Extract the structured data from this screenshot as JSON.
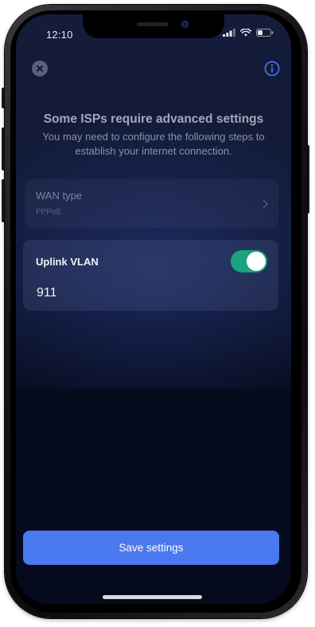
{
  "status_bar": {
    "time": "12:10",
    "signal_icon": "cellular-signal-icon",
    "wifi_icon": "wifi-icon",
    "battery_icon": "battery-icon"
  },
  "header": {
    "close_icon": "close-icon",
    "info_icon": "info-icon"
  },
  "intro": {
    "title": "Some ISPs require advanced settings",
    "description": "You may need to configure the following steps to establish your internet connection."
  },
  "wan_type": {
    "label": "WAN type",
    "value": "PPPoE",
    "chevron_icon": "chevron-right-icon"
  },
  "uplink_vlan": {
    "label": "Uplink VLAN",
    "enabled": true,
    "value": "911"
  },
  "actions": {
    "save_label": "Save settings"
  },
  "colors": {
    "background": "#050b1d",
    "accent": "#4a78ee",
    "toggle_on": "#1aa37d"
  }
}
